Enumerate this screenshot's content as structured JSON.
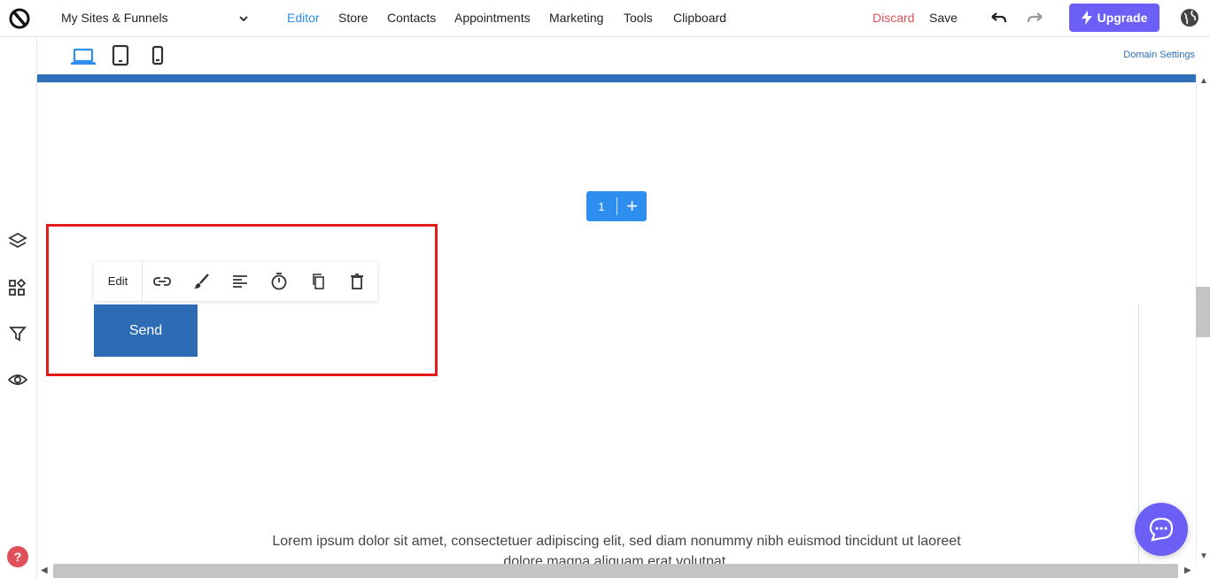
{
  "topbar": {
    "sites_label": "My Sites & Funnels",
    "nav": [
      "Editor",
      "Store",
      "Contacts",
      "Appointments",
      "Marketing",
      "Tools",
      "Clipboard"
    ],
    "discard": "Discard",
    "save": "Save",
    "upgrade": "Upgrade"
  },
  "devicebar": {
    "domain_settings": "Domain Settings"
  },
  "canvas": {
    "row_number": "1",
    "row_add": "+",
    "toolbar_edit": "Edit",
    "send_label": "Send",
    "lorem": "Lorem ipsum dolor sit amet, consectetuer adipiscing elit, sed diam nonummy nibh euismod tincidunt ut laoreet dolore magna aliquam erat volutpat."
  },
  "sidebar": {
    "help": "?"
  },
  "colors": {
    "accent": "#2d8ef0",
    "upgrade": "#6b5ff5",
    "discard": "#e0505a",
    "button": "#2d6cb4",
    "highlight": "#e41b1b"
  }
}
